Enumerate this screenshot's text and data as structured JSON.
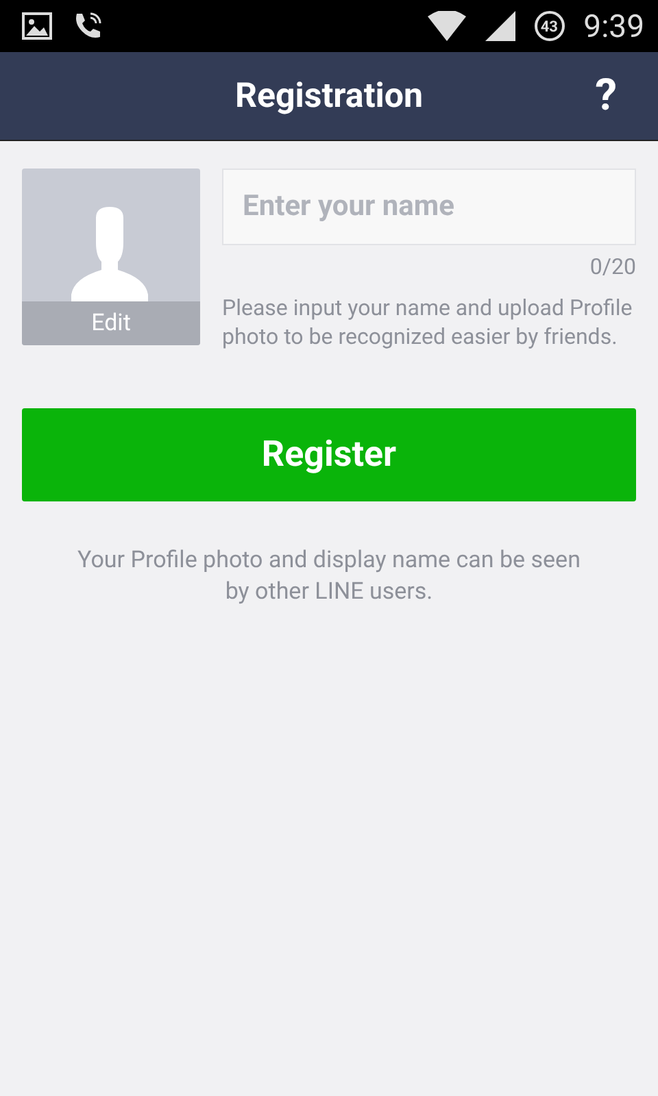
{
  "status_bar": {
    "battery": "43",
    "time": "9:39"
  },
  "header": {
    "title": "Registration",
    "help": "?"
  },
  "profile": {
    "edit": "Edit"
  },
  "name_field": {
    "placeholder": "Enter your name",
    "counter": "0/20",
    "hint": "Please input your name and upload Profile photo to be recognized easier by friends."
  },
  "register_button": "Register",
  "notice": "Your Profile photo and display name can be seen by other LINE users."
}
